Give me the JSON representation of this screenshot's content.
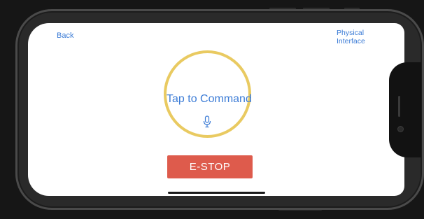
{
  "nav": {
    "back_label": "Back",
    "physical_line1": "Physical",
    "physical_line2": "Interface"
  },
  "command": {
    "label": "Tap to Command",
    "icon": "microphone-icon"
  },
  "estop": {
    "label": "E-STOP"
  },
  "colors": {
    "accent_blue": "#3c7cd6",
    "ring_yellow": "#e9ca61",
    "estop_red": "#de5b4c"
  }
}
